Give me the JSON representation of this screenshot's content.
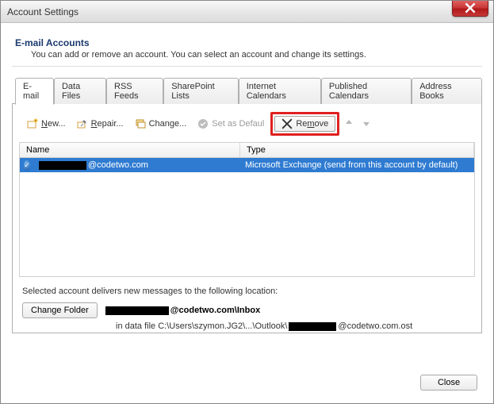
{
  "window": {
    "title": "Account Settings"
  },
  "section": {
    "title": "E-mail Accounts",
    "subtitle": "You can add or remove an account. You can select an account and change its settings."
  },
  "tabs": [
    {
      "label": "E-mail",
      "active": true
    },
    {
      "label": "Data Files"
    },
    {
      "label": "RSS Feeds"
    },
    {
      "label": "SharePoint Lists"
    },
    {
      "label": "Internet Calendars"
    },
    {
      "label": "Published Calendars"
    },
    {
      "label": "Address Books"
    }
  ],
  "toolbar": {
    "new": "ew...",
    "new_prefix": "N",
    "repair": "epair...",
    "repair_prefix": "R",
    "change": "Change...",
    "set_default": "Set as Defaul",
    "remove": "Re",
    "remove_suffix": "ove",
    "remove_mid": "m"
  },
  "columns": {
    "name": "Name",
    "type": "Type"
  },
  "accounts": [
    {
      "email_visible_suffix": "@codetwo.com",
      "type": "Microsoft Exchange (send from this account by default)",
      "selected": true,
      "default": true
    }
  ],
  "delivery": {
    "line": "Selected account delivers new messages to the following location:",
    "change_folder": "Change Folder",
    "location_suffix": "@codetwo.com\\Inbox",
    "datafile_prefix": "in data file C:\\Users\\szymon.JG2\\...\\Outlook\\",
    "datafile_suffix": "@codetwo.com.ost"
  },
  "buttons": {
    "close": "Close"
  }
}
